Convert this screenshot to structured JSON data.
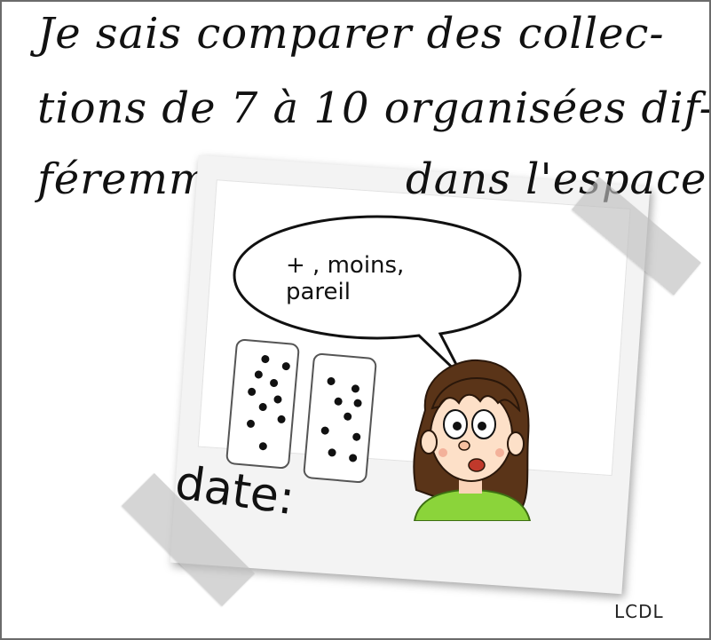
{
  "title": {
    "line1": "Je sais comparer des collec-",
    "line2": "tions de 7 à 10 organisées dif-",
    "line3a": "féremment",
    "line3b": "dans l'espace."
  },
  "speech_bubble": {
    "line1": "+ , moins,",
    "line2": "pareil"
  },
  "cards": {
    "card1_dots": 10,
    "card2_dots": 9
  },
  "date_label": "date:",
  "credit": "LCDL",
  "colors": {
    "border": "#6b6b6b",
    "text": "#111111",
    "shirt": "#8bd43a",
    "hair": "#5a3418"
  }
}
